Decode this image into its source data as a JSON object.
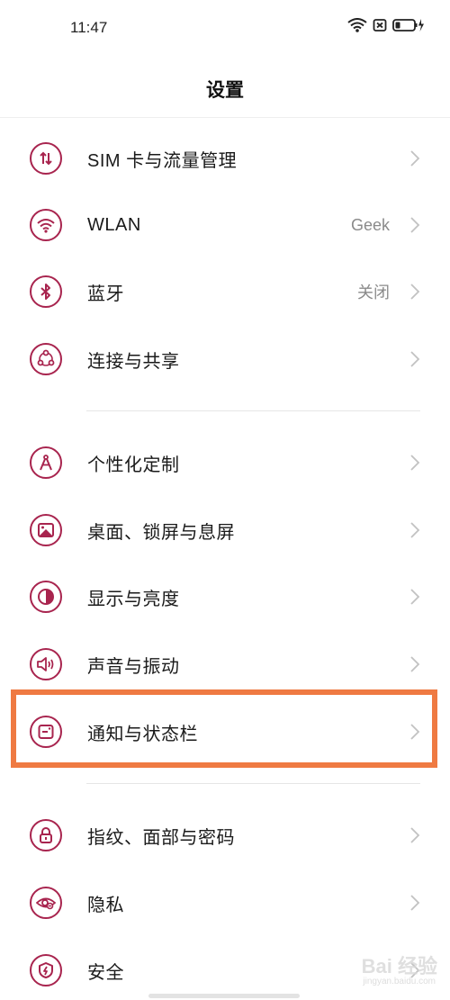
{
  "status_bar": {
    "time": "11:47",
    "icons": [
      "wifi-icon",
      "sim-absent-icon",
      "battery-charging-icon"
    ]
  },
  "header": {
    "title": "设置"
  },
  "settings": [
    {
      "label": "SIM 卡与流量管理",
      "value": "",
      "icon": "sim-data-icon"
    },
    {
      "label": "WLAN",
      "value": "Geek",
      "icon": "wifi-icon"
    },
    {
      "label": "蓝牙",
      "value": "关闭",
      "icon": "bluetooth-icon"
    },
    {
      "label": "连接与共享",
      "value": "",
      "icon": "share-icon"
    },
    {
      "label": "个性化定制",
      "value": "",
      "icon": "compass-icon"
    },
    {
      "label": "桌面、锁屏与息屏",
      "value": "",
      "icon": "wallpaper-icon"
    },
    {
      "label": "显示与亮度",
      "value": "",
      "icon": "brightness-icon"
    },
    {
      "label": "声音与振动",
      "value": "",
      "icon": "speaker-icon"
    },
    {
      "label": "通知与状态栏",
      "value": "",
      "icon": "notification-icon",
      "highlighted": true
    },
    {
      "label": "指纹、面部与密码",
      "value": "",
      "icon": "lock-icon"
    },
    {
      "label": "隐私",
      "value": "",
      "icon": "privacy-eye-icon"
    },
    {
      "label": "安全",
      "value": "",
      "icon": "security-shield-icon"
    }
  ],
  "watermark": {
    "text": "Bai 经验",
    "sub": "jingyan.baidu.com"
  },
  "colors": {
    "icon_accent": "#a8244e",
    "highlight": "#ef7a42",
    "chevron": "#c2c2c2",
    "secondary_text": "#8a8a8a"
  }
}
